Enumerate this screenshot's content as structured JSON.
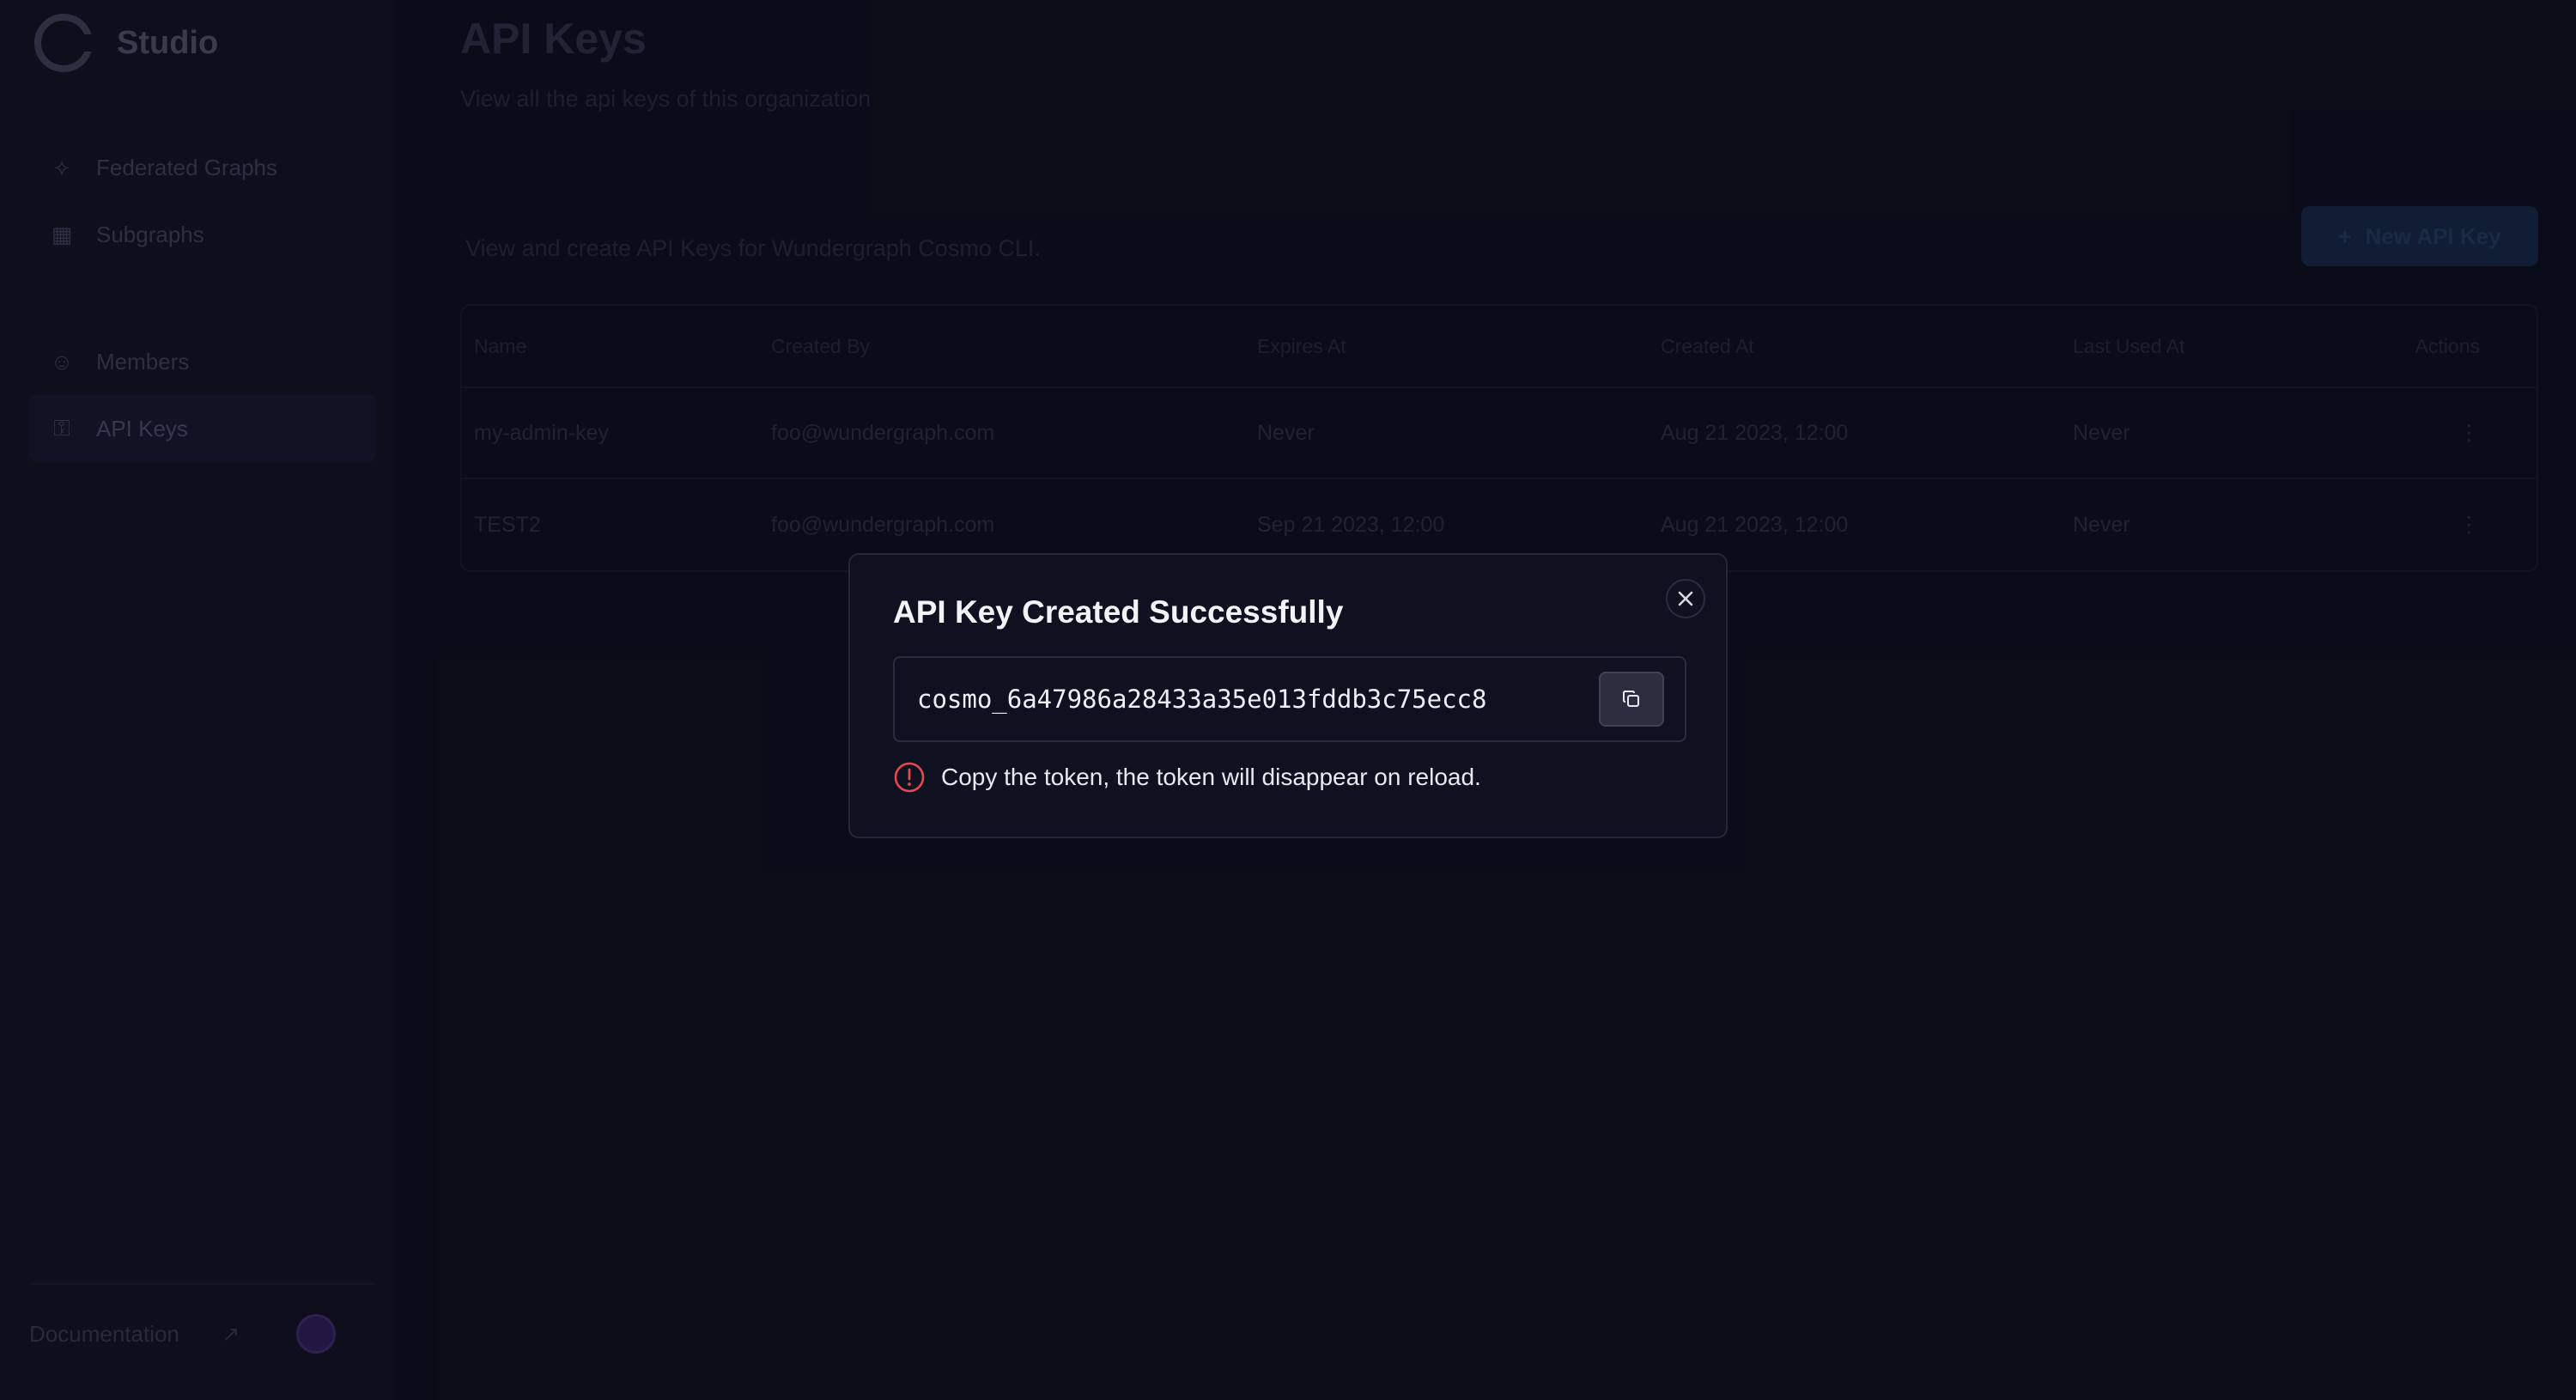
{
  "sidebar": {
    "brand": {
      "name": "Studio"
    },
    "nav_top": [
      {
        "label": "Federated Graphs",
        "icon": "graph-icon"
      },
      {
        "label": "Subgraphs",
        "icon": "grid-icon"
      }
    ],
    "nav_bottom": [
      {
        "label": "Members",
        "icon": "users-icon"
      },
      {
        "label": "API Keys",
        "icon": "key-icon",
        "active": true
      }
    ],
    "footer": {
      "docs_label": "Documentation",
      "icon": "external-link-icon"
    }
  },
  "main": {
    "title": "API Keys",
    "subtitle": "View all the api keys of this organization",
    "section_description": "View and create API Keys for Wundergraph Cosmo CLI.",
    "new_key_button": "New API Key",
    "table": {
      "headers": [
        "Name",
        "Created By",
        "Expires At",
        "Created At",
        "Last Used At",
        "Actions"
      ],
      "rows": [
        [
          "my-admin-key",
          "foo@wundergraph.com",
          "Never",
          "Aug 21 2023, 12:00",
          "Never",
          "⋮"
        ],
        [
          "TEST2",
          "foo@wundergraph.com",
          "Sep 21 2023, 12:00",
          "Aug 21 2023, 12:00",
          "Never",
          "⋮"
        ]
      ]
    }
  },
  "dialog": {
    "title": "API Key Created Successfully",
    "token": "cosmo_6a47986a28433a35e013fddb3c75ecc8",
    "warning": "Copy the token, the token will disappear on reload.",
    "warning_color": "#e5484d",
    "copy_icon": "copy-icon",
    "close_icon": "close-icon"
  }
}
